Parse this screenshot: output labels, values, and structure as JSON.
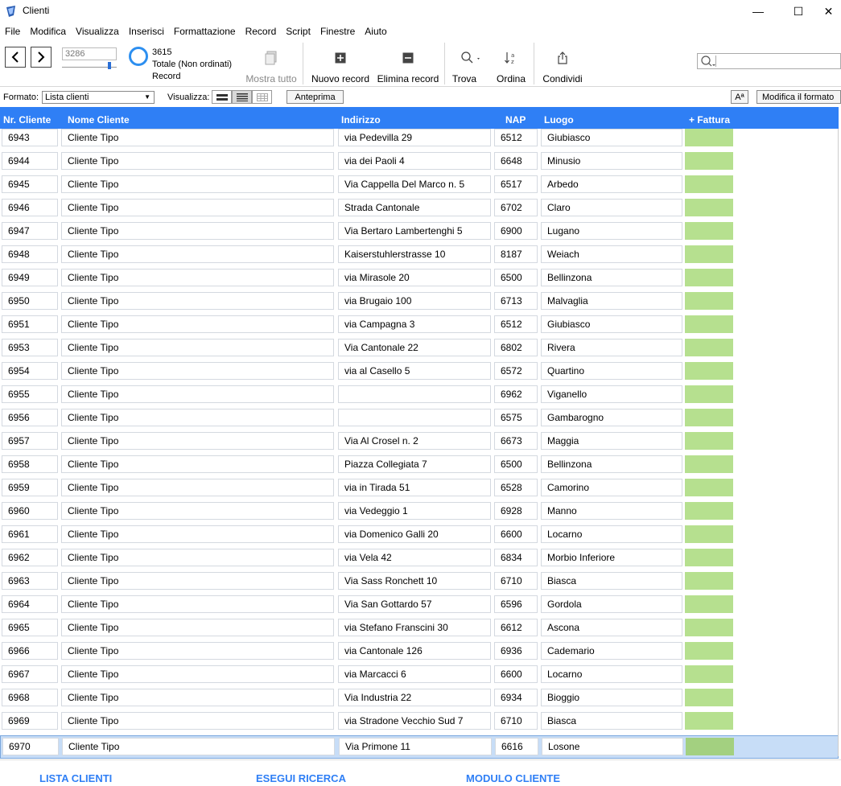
{
  "window": {
    "title": "Clienti",
    "minimize": "—",
    "maximize": "☐",
    "close": "✕"
  },
  "menu": [
    "File",
    "Modifica",
    "Visualizza",
    "Inserisci",
    "Formattazione",
    "Record",
    "Script",
    "Finestre",
    "Aiuto"
  ],
  "toolbar": {
    "record_number": "3286",
    "total": "3615",
    "total_label": "Totale (Non ordinati)",
    "record_label": "Record",
    "show_all": "Mostra tutto",
    "new_record": "Nuovo record",
    "delete_record": "Elimina record",
    "find": "Trova",
    "sort": "Ordina",
    "share": "Condividi"
  },
  "layoutbar": {
    "format_label": "Formato:",
    "format_value": "Lista clienti",
    "view_label": "Visualizza:",
    "preview": "Anteprima",
    "font_btn": "Aª",
    "edit_layout": "Modifica il formato"
  },
  "columns": {
    "nr": "Nr. Cliente",
    "nome": "Nome Cliente",
    "indirizzo": "Indirizzo",
    "nap": "NAP",
    "luogo": "Luogo",
    "fattura": "+ Fattura"
  },
  "rows": [
    {
      "nr": "6943",
      "nome": "Cliente Tipo",
      "indirizzo": "via Pedevilla 29",
      "nap": "6512",
      "luogo": "Giubiasco"
    },
    {
      "nr": "6944",
      "nome": "Cliente Tipo",
      "indirizzo": "via dei Paoli 4",
      "nap": "6648",
      "luogo": "Minusio"
    },
    {
      "nr": "6945",
      "nome": "Cliente Tipo",
      "indirizzo": "Via Cappella Del Marco n. 5",
      "nap": "6517",
      "luogo": "Arbedo"
    },
    {
      "nr": "6946",
      "nome": "Cliente Tipo",
      "indirizzo": "Strada Cantonale",
      "nap": "6702",
      "luogo": "Claro"
    },
    {
      "nr": "6947",
      "nome": "Cliente Tipo",
      "indirizzo": "Via Bertaro Lambertenghi 5",
      "nap": "6900",
      "luogo": "Lugano"
    },
    {
      "nr": "6948",
      "nome": "Cliente Tipo",
      "indirizzo": "Kaiserstuhlerstrasse 10",
      "nap": "8187",
      "luogo": "Weiach"
    },
    {
      "nr": "6949",
      "nome": "Cliente Tipo",
      "indirizzo": "via Mirasole 20",
      "nap": "6500",
      "luogo": "Bellinzona"
    },
    {
      "nr": "6950",
      "nome": "Cliente Tipo",
      "indirizzo": "via Brugaio 100",
      "nap": "6713",
      "luogo": "Malvaglia"
    },
    {
      "nr": "6951",
      "nome": "Cliente Tipo",
      "indirizzo": "via Campagna 3",
      "nap": "6512",
      "luogo": "Giubiasco"
    },
    {
      "nr": "6953",
      "nome": "Cliente Tipo",
      "indirizzo": "Via Cantonale 22",
      "nap": "6802",
      "luogo": "Rivera"
    },
    {
      "nr": "6954",
      "nome": "Cliente Tipo",
      "indirizzo": "via al Casello 5",
      "nap": "6572",
      "luogo": "Quartino"
    },
    {
      "nr": "6955",
      "nome": "Cliente Tipo",
      "indirizzo": "",
      "nap": "6962",
      "luogo": "Viganello"
    },
    {
      "nr": "6956",
      "nome": "Cliente Tipo",
      "indirizzo": "",
      "nap": "6575",
      "luogo": "Gambarogno"
    },
    {
      "nr": "6957",
      "nome": "Cliente Tipo",
      "indirizzo": "Via Al Crosel n. 2",
      "nap": "6673",
      "luogo": "Maggia"
    },
    {
      "nr": "6958",
      "nome": "Cliente Tipo",
      "indirizzo": "Piazza Collegiata 7",
      "nap": "6500",
      "luogo": "Bellinzona"
    },
    {
      "nr": "6959",
      "nome": "Cliente Tipo",
      "indirizzo": "via in Tirada 51",
      "nap": "6528",
      "luogo": "Camorino"
    },
    {
      "nr": "6960",
      "nome": "Cliente Tipo",
      "indirizzo": "via Vedeggio 1",
      "nap": "6928",
      "luogo": "Manno"
    },
    {
      "nr": "6961",
      "nome": "Cliente Tipo",
      "indirizzo": "via Domenico Galli 20",
      "nap": "6600",
      "luogo": "Locarno"
    },
    {
      "nr": "6962",
      "nome": "Cliente Tipo",
      "indirizzo": "via Vela 42",
      "nap": "6834",
      "luogo": "Morbio Inferiore"
    },
    {
      "nr": "6963",
      "nome": "Cliente Tipo",
      "indirizzo": "Via Sass Ronchett 10",
      "nap": "6710",
      "luogo": "Biasca"
    },
    {
      "nr": "6964",
      "nome": "Cliente Tipo",
      "indirizzo": "Via San Gottardo 57",
      "nap": "6596",
      "luogo": "Gordola"
    },
    {
      "nr": "6965",
      "nome": "Cliente Tipo",
      "indirizzo": "via Stefano Franscini 30",
      "nap": "6612",
      "luogo": "Ascona"
    },
    {
      "nr": "6966",
      "nome": "Cliente Tipo",
      "indirizzo": "via Cantonale 126",
      "nap": "6936",
      "luogo": "Cademario"
    },
    {
      "nr": "6967",
      "nome": "Cliente Tipo",
      "indirizzo": "via Marcacci 6",
      "nap": "6600",
      "luogo": "Locarno"
    },
    {
      "nr": "6968",
      "nome": "Cliente Tipo",
      "indirizzo": "Via Industria 22",
      "nap": "6934",
      "luogo": "Bioggio"
    },
    {
      "nr": "6969",
      "nome": "Cliente Tipo",
      "indirizzo": "via Stradone Vecchio Sud 7",
      "nap": "6710",
      "luogo": "Biasca"
    },
    {
      "nr": "6970",
      "nome": "Cliente Tipo",
      "indirizzo": "Via Primone 11",
      "nap": "6616",
      "luogo": "Losone"
    }
  ],
  "selected_row": 26,
  "footer": {
    "list": "LISTA CLIENTI",
    "search": "ESEGUI RICERCA",
    "form": "MODULO CLIENTE"
  },
  "colors": {
    "header": "#2f7ff5",
    "fattura": "#b6e08f",
    "selected": "#c7ddf7"
  }
}
